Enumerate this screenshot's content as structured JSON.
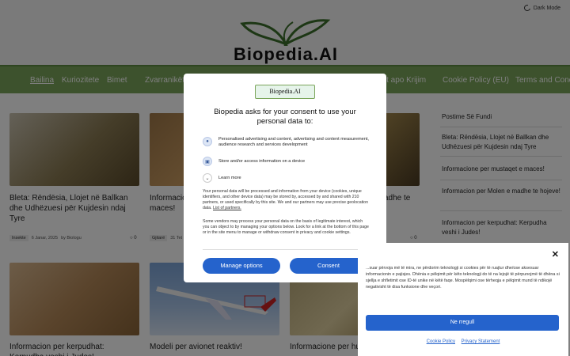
{
  "header": {
    "dark_mode_label": "Dark Mode",
    "logo_text": "Biopedia.AI"
  },
  "nav": {
    "items": [
      {
        "label": "Bailina",
        "active": true
      },
      {
        "label": "Kuriozitete"
      },
      {
        "label": "Bimet"
      },
      {
        "label": "Zvarranikët"
      },
      {
        "label": "Krimet apo Krijim"
      },
      {
        "label": "Cookie Policy (EU)"
      },
      {
        "label": "Terms and Conditions"
      }
    ]
  },
  "posts": [
    {
      "title": "Bleta: Rëndësia, Llojet në Ballkan dhe Udhëzuesi për Kujdesin ndaj Tyre",
      "tag": "Insekte",
      "date": "6 Janar, 2025",
      "author": "by Biologu",
      "comments": "0"
    },
    {
      "title": "Informacione per mustaqet e maces!",
      "tag": "Gjitarë",
      "date": "31 Tet",
      "comments": "0"
    },
    {
      "title": "Informacion per Molen e madhe te hojeve!",
      "comments": "0"
    },
    {
      "title": "Informacion per kerpudhat: Kerpudha veshi i Judes!"
    },
    {
      "title": "Modeli per avionet reaktiv!"
    },
    {
      "title": "Informacione per hu"
    }
  ],
  "sidebar": {
    "title": "Postime Së Fundi",
    "items": [
      "Bleta: Rëndësia, Llojet në Ballkan dhe Udhëzuesi për Kujdesin ndaj Tyre",
      "Informacione per mustaqet e maces!",
      "Informacion per Molen e madhe te hojeve!",
      "Informacion per kerpudhat: Kerpudha veshi i Judes!"
    ]
  },
  "consent_modal": {
    "logo_text": "Biopedia.AI",
    "title": "Biopedia asks for your consent to use your personal data to:",
    "purposes": [
      "Personalised advertising and content, advertising and content measurement, audience research and services development",
      "Store and/or access information on a device",
      "Learn more"
    ],
    "body1": "Your personal data will be processed and information from your device (cookies, unique identifiers, and other device data) may be stored by, accessed by and shared with 210 partners, or used specifically by this site. We and our partners may use precise geolocation data.",
    "partners_link": "List of partners.",
    "body2": "Some vendors may process your personal data on the basis of legitimate interest, which you can object to by managing your options below. Look for a link at the bottom of this page or in the site menu to manage or withdraw consent in privacy and cookie settings.",
    "manage_label": "Manage options",
    "consent_label": "Consent"
  },
  "cookie_panel": {
    "text": "...suar përvoja më të mira, ne përdorim teknologji si cookies për të ruajtur dhe/ose aksesuar informacionin e pajisjes. Dhënia e pëlqimit për këto teknologji do të na lejojë të përpunojmë të dhëna si sjellja e shfletimit ose ID-të unike në këtë faqe. Mospëlqimi ose tërheqja e pëlqimit mund të ndikojë negativisht të disa funksione dhe veçori.",
    "accept_label": "Ne rregull",
    "cookie_policy_link": "Cookie Policy",
    "privacy_link": "Privacy Statement"
  },
  "colors": {
    "nav_green": "#7aa55a",
    "primary_blue": "#2563cc"
  }
}
